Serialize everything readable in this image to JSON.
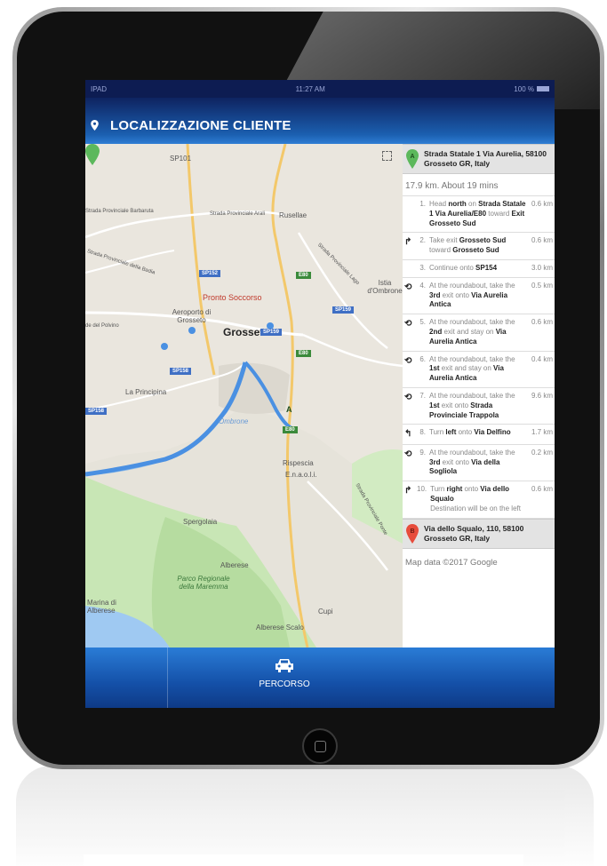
{
  "status_bar": {
    "left": "IPAD",
    "time": "11:27 AM",
    "battery": "100 %"
  },
  "header": {
    "title": "LOCALIZZAZIONE CLIENTE"
  },
  "map": {
    "labels": {
      "sp101": "SP101",
      "barbaruta": "Strada Provinciale Barbaruta",
      "arali": "Strada Provinciale Arali",
      "rusellae": "Rusellae",
      "della_badia": "Strada Provinciale della Badia",
      "istia": "Istia d'Ombrone",
      "pronto_soccorso": "Pronto Soccorso",
      "aeroporto": "Aeroporto di Grosseto",
      "grosseto": "Grosseto",
      "del_polvino": "de del Polvino",
      "la_principina": "La Principina",
      "ombrone": "Ombrone",
      "rispescia": "Rispescia",
      "enaoli": "E.n.a.o.l.i.",
      "spergolaia": "Spergolaia",
      "alberese": "Alberese",
      "parco": "Parco Regionale della Maremma",
      "marina": "Marina di Alberese",
      "cupi": "Cupi",
      "alberese_scalo": "Alberese Scalo",
      "strada_lago": "Strada Provinciale Lago",
      "strada_ponte": "Strada Provinciale Ponte",
      "sp152": "SP152",
      "sp158": "SP158",
      "sp158b": "SP158",
      "sp159": "SP159",
      "sp159b": "SP159",
      "e80": "E80",
      "e80b": "E80",
      "e80c": "E80"
    },
    "pin_label": "A"
  },
  "directions": {
    "origin": {
      "marker": "A",
      "address": "Strada Statale 1 Via Aurelia, 58100 Grosseto GR, Italy"
    },
    "summary": "17.9 km. About 19 mins",
    "steps": [
      {
        "num": "1.",
        "icon": "",
        "parts": [
          "Head ",
          "north",
          " on ",
          "Strada Statale 1 Via Aurelia/E80",
          " toward ",
          "Exit Grosseto Sud"
        ],
        "note": "",
        "distance": "0.6 km"
      },
      {
        "num": "2.",
        "icon": "↱",
        "parts": [
          "Take exit ",
          "Grosseto Sud",
          " toward ",
          "Grosseto Sud",
          "",
          ""
        ],
        "note": "",
        "distance": "0.6 km"
      },
      {
        "num": "3.",
        "icon": "",
        "parts": [
          "Continue onto ",
          "SP154",
          "",
          "",
          "",
          ""
        ],
        "note": "",
        "distance": "3.0 km"
      },
      {
        "num": "4.",
        "icon": "⟲",
        "parts": [
          "At the roundabout, take the ",
          "3rd",
          " exit onto ",
          "Via Aurelia Antica",
          "",
          ""
        ],
        "note": "",
        "distance": "0.5 km"
      },
      {
        "num": "5.",
        "icon": "⟲",
        "parts": [
          "At the roundabout, take the ",
          "2nd",
          " exit and stay on ",
          "Via Aurelia Antica",
          "",
          ""
        ],
        "note": "",
        "distance": "0.6 km"
      },
      {
        "num": "6.",
        "icon": "⟲",
        "parts": [
          "At the roundabout, take the ",
          "1st",
          " exit and stay on ",
          "Via Aurelia Antica",
          "",
          ""
        ],
        "note": "",
        "distance": "0.4 km"
      },
      {
        "num": "7.",
        "icon": "⟲",
        "parts": [
          "At the roundabout, take the ",
          "1st",
          " exit onto ",
          "Strada Provinciale Trappola",
          "",
          ""
        ],
        "note": "",
        "distance": "9.6 km"
      },
      {
        "num": "8.",
        "icon": "↰",
        "parts": [
          "Turn ",
          "left",
          " onto ",
          "Via Delfino",
          "",
          ""
        ],
        "note": "",
        "distance": "1.7 km"
      },
      {
        "num": "9.",
        "icon": "⟲",
        "parts": [
          "At the roundabout, take the ",
          "3rd",
          " exit onto ",
          "Via della Sogliola",
          "",
          ""
        ],
        "note": "",
        "distance": "0.2 km"
      },
      {
        "num": "10.",
        "icon": "↱",
        "parts": [
          "Turn ",
          "right",
          " onto ",
          "Via dello Squalo",
          "",
          ""
        ],
        "note": "Destination will be on the left",
        "distance": "0.6 km"
      }
    ],
    "destination": {
      "marker": "B",
      "address": "Via dello Squalo, 110, 58100 Grosseto GR, Italy"
    },
    "attribution": "Map data ©2017 Google"
  },
  "tabbar": {
    "active_label": "PERCORSO"
  },
  "colors": {
    "route": "#4a90e2",
    "marker_a": "#5cb85c",
    "marker_b": "#e74c3c",
    "header": "#0e2360",
    "tabbar": "#1d5fb5"
  }
}
